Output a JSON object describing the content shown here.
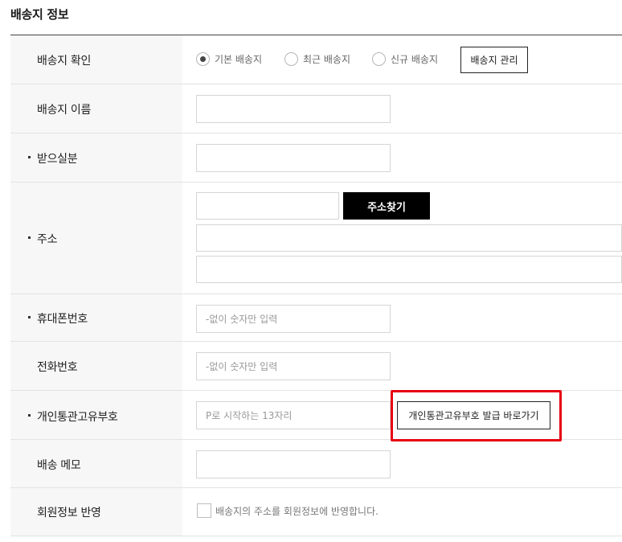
{
  "section": {
    "title": "배송지 정보"
  },
  "rows": {
    "confirm": {
      "label": "배송지 확인",
      "options": [
        {
          "label": "기본 배송지",
          "checked": true
        },
        {
          "label": "최근 배송지",
          "checked": false
        },
        {
          "label": "신규 배송지",
          "checked": false
        }
      ],
      "manage_button": "배송지 관리"
    },
    "name": {
      "label": "배송지 이름",
      "value": ""
    },
    "recipient": {
      "label": "받으실분",
      "value": ""
    },
    "address": {
      "label": "주소",
      "zip": "",
      "search_button": "주소찾기",
      "line1": "",
      "line2": ""
    },
    "mobile": {
      "label": "휴대폰번호",
      "placeholder": "-없이 숫자만 입력"
    },
    "phone": {
      "label": "전화번호",
      "placeholder": "-없이 숫자만 입력"
    },
    "customs": {
      "label": "개인통관고유부호",
      "placeholder": "P로 시작하는 13자리",
      "issue_button": "개인통관고유부호 발급 바로가기"
    },
    "memo": {
      "label": "배송 메모",
      "value": ""
    },
    "reflect": {
      "label": "회원정보 반영",
      "checkbox_label": "배송지의 주소를 회원정보에 반영합니다.",
      "checked": false
    }
  },
  "colors": {
    "accent_black": "#000000",
    "highlight_red": "#e60012",
    "label_bg": "#f7f7f7"
  }
}
